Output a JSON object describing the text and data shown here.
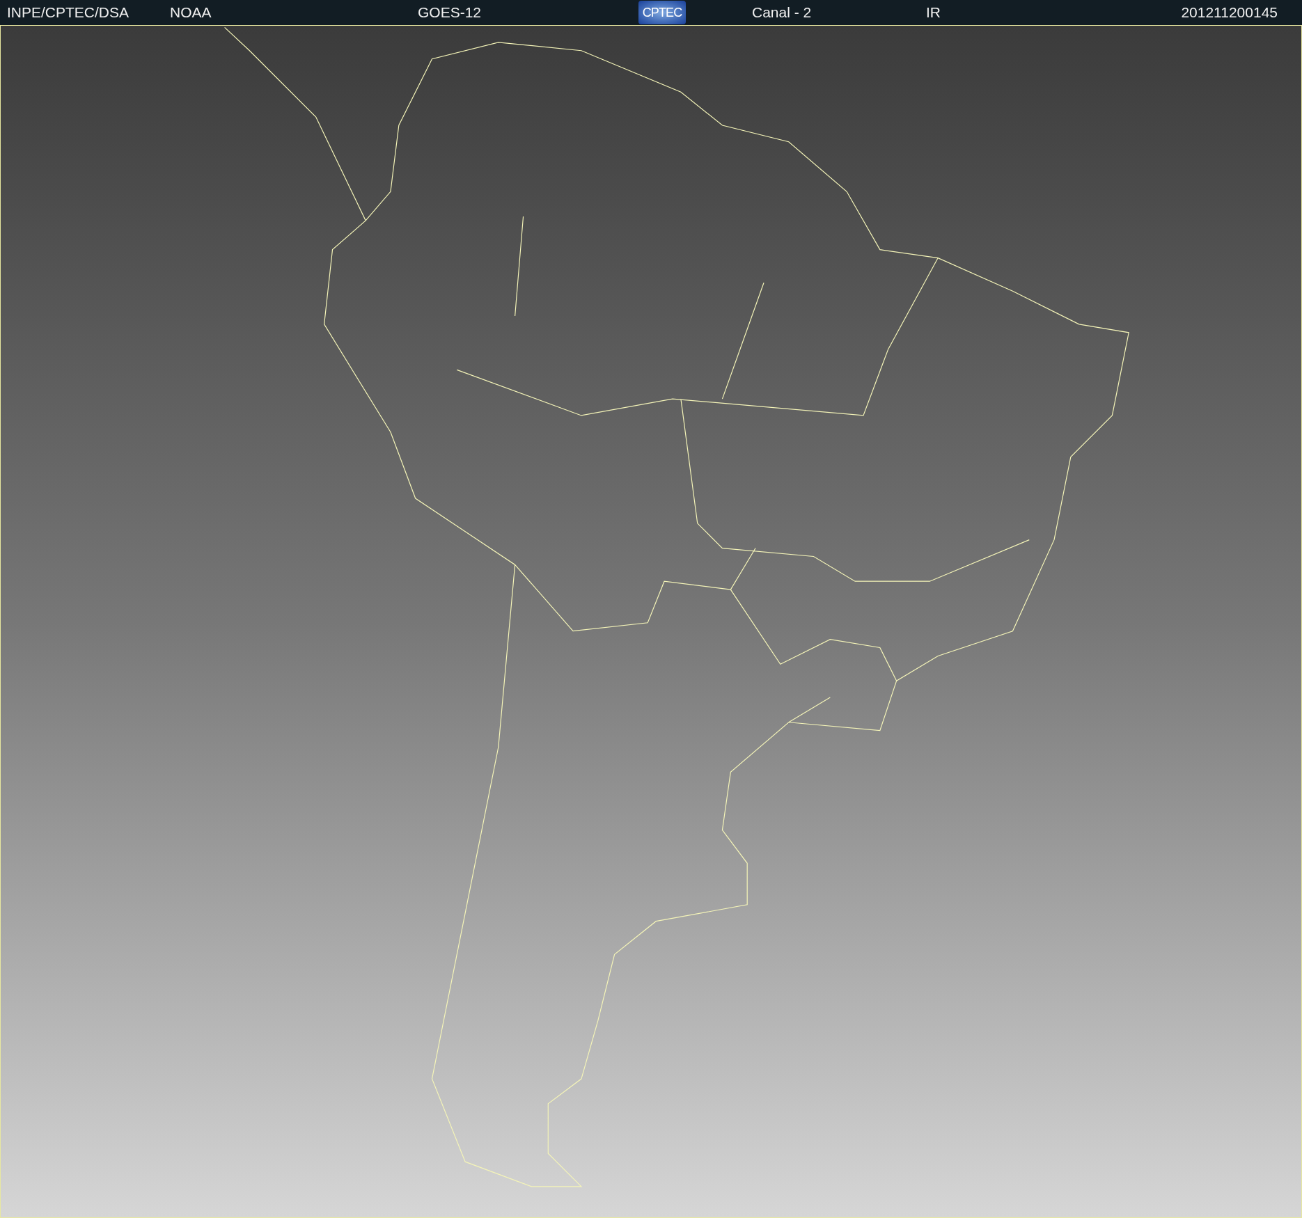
{
  "header": {
    "items": [
      {
        "kind": "text",
        "text": "INPE/CPTEC/DSA"
      },
      {
        "kind": "text",
        "text": "NOAA"
      },
      {
        "kind": "text",
        "text": "GOES-12"
      },
      {
        "kind": "logo",
        "text": "CPTEC"
      },
      {
        "kind": "text",
        "text": "Canal - 2"
      },
      {
        "kind": "text",
        "text": "IR"
      },
      {
        "kind": "text",
        "text": "201211200145"
      }
    ]
  }
}
